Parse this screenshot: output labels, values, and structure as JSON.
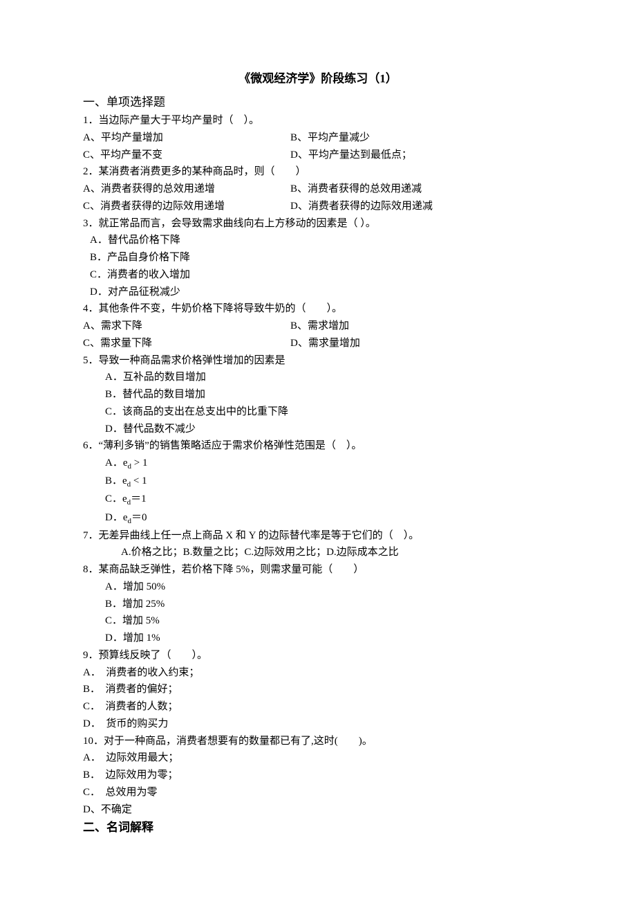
{
  "title": "《微观经济学》阶段练习（1）",
  "section1": "一、单项选择题",
  "q1": {
    "stem": "1．当边际产量大于平均产量时（　）。",
    "a": "A、平均产量增加",
    "b": "B、平均产量减少",
    "c": "C、平均产量不变",
    "d": "D、平均产量达到最低点；"
  },
  "q2": {
    "stem": "2．某消费者消费更多的某种商品时，则（　　）",
    "a": "A、消费者获得的总效用递增",
    "b": "B、消费者获得的总效用递减",
    "c": "C、消费者获得的边际效用递增",
    "d": "D、消费者获得的边际效用递减"
  },
  "q3": {
    "stem": "3．就正常品而言，会导致需求曲线向右上方移动的因素是（ ）。",
    "a": "A．替代品价格下降",
    "b": "B．产品自身价格下降",
    "c": "C．消费者的收入增加",
    "d": "D．对产品征税减少"
  },
  "q4": {
    "stem": "4．其他条件不变，牛奶价格下降将导致牛奶的（　　）。",
    "a": "A、需求下降",
    "b": "B、需求增加",
    "c": "C、需求量下降",
    "d": "D、需求量增加"
  },
  "q5": {
    "stem": "5．导致一种商品需求价格弹性增加的因素是",
    "a": "A．互补品的数目增加",
    "b": "B．替代品的数目增加",
    "c": "C．该商品的支出在总支出中的比重下降",
    "d": "D．替代品数不减少"
  },
  "q6": {
    "stem": "6．“薄利多销”的销售策略适应于需求价格弹性范围是（　）。",
    "a_pre": "A．e",
    "a_post": " > 1",
    "b_pre": "B．e",
    "b_post": " < 1",
    "c_pre": "C．e",
    "c_post": "＝1",
    "d_pre": "D．e",
    "d_post": "＝0",
    "sub": "d"
  },
  "q7": {
    "stem": "7．无差异曲线上任一点上商品 X 和 Y 的边际替代率是等于它们的（　）。",
    "opts": "A.价格之比；B.数量之比；C.边际效用之比；D.边际成本之比"
  },
  "q8": {
    "stem": "8．某商品缺乏弹性，若价格下降 5%，则需求量可能（　　）",
    "a": "A．增加 50%",
    "b": "B．增加 25%",
    "c": "C．增加 5%",
    "d": "D．增加 1%"
  },
  "q9": {
    "stem": "9．预算线反映了（　　）。",
    "a": "A．　消费者的收入约束；",
    "b": "B．　消费者的偏好；",
    "c": "C．　消费者的人数；",
    "d": "D．　货币的购买力"
  },
  "q10": {
    "stem": "10．对于一种商品，消费者想要有的数量都已有了,这时(　　)。",
    "a": "A．　边际效用最大；",
    "b": "B．　边际效用为零；",
    "c": "C．　总效用为零",
    "d": "D、不确定"
  },
  "section2": "二、名词解释"
}
